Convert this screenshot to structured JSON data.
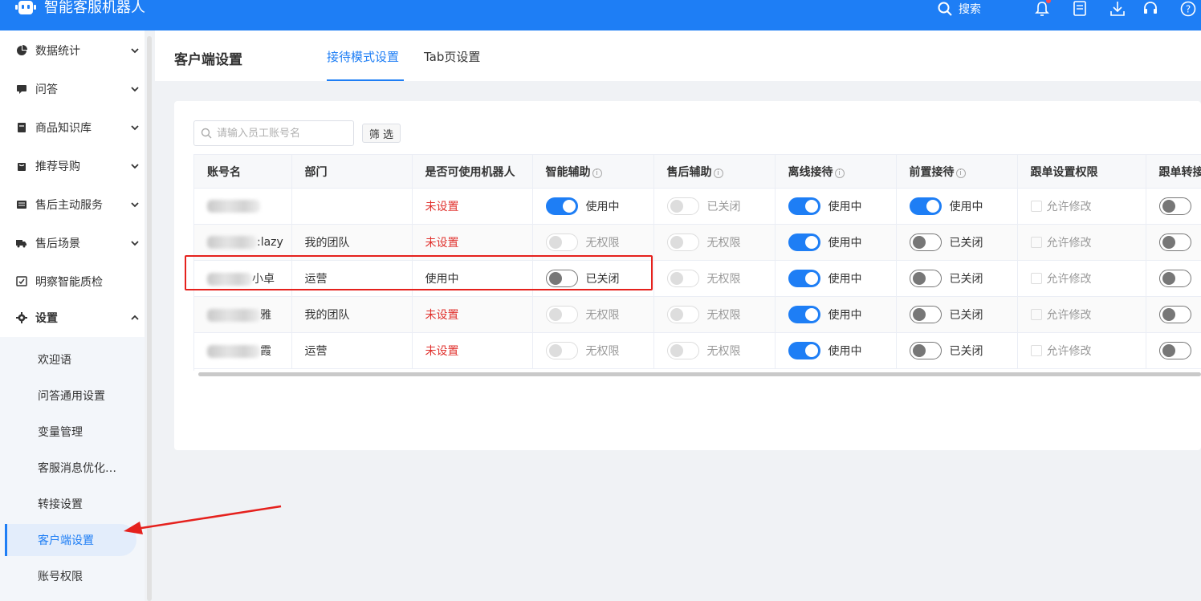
{
  "app": {
    "title": "智能客服机器人"
  },
  "topbar": {
    "search_label": "搜索"
  },
  "sidebar": {
    "items": [
      {
        "label": "数据统计"
      },
      {
        "label": "问答"
      },
      {
        "label": "商品知识库"
      },
      {
        "label": "推荐导购"
      },
      {
        "label": "售后主动服务"
      },
      {
        "label": "售后场景"
      },
      {
        "label": "明察智能质检"
      },
      {
        "label": "设置"
      }
    ],
    "submenu": [
      {
        "label": "欢迎语"
      },
      {
        "label": "问答通用设置"
      },
      {
        "label": "变量管理"
      },
      {
        "label": "客服消息优化…"
      },
      {
        "label": "转接设置"
      },
      {
        "label": "客户端设置"
      },
      {
        "label": "账号权限"
      }
    ]
  },
  "page": {
    "title": "客户端设置",
    "tabs": [
      {
        "label": "接待模式设置"
      },
      {
        "label": "Tab页设置"
      }
    ]
  },
  "filters": {
    "search_placeholder": "请输入员工账号名",
    "filter_button": "筛 选"
  },
  "table": {
    "headers": {
      "account": "账号名",
      "dept": "部门",
      "robot": "是否可使用机器人",
      "smart": "智能辅助",
      "aftersale": "售后辅助",
      "offline": "离线接待",
      "front": "前置接待",
      "follow_perm": "跟单设置权限",
      "follow_transfer": "跟单转接"
    },
    "info_glyph": "i",
    "rows": [
      {
        "account": "",
        "dept": "",
        "robot": "未设置",
        "smart": "使用中",
        "aftersale": "已关闭",
        "offline": "使用中",
        "front": "使用中",
        "follow_perm": "允许修改"
      },
      {
        "account": ":lazy",
        "dept": "我的团队",
        "robot": "未设置",
        "smart": "无权限",
        "aftersale": "无权限",
        "offline": "使用中",
        "front": "已关闭",
        "follow_perm": "允许修改"
      },
      {
        "account": "小卓",
        "dept": "运营",
        "robot": "使用中",
        "smart": "已关闭",
        "aftersale": "无权限",
        "offline": "使用中",
        "front": "已关闭",
        "follow_perm": "允许修改"
      },
      {
        "account": "雅",
        "dept": "我的团队",
        "robot": "未设置",
        "smart": "无权限",
        "aftersale": "无权限",
        "offline": "使用中",
        "front": "已关闭",
        "follow_perm": "允许修改"
      },
      {
        "account": "霞",
        "dept": "运营",
        "robot": "未设置",
        "smart": "无权限",
        "aftersale": "无权限",
        "offline": "使用中",
        "front": "已关闭",
        "follow_perm": "允许修改"
      }
    ]
  },
  "colors": {
    "accent": "#1e7ef5",
    "danger": "#e0312d",
    "annotation": "#e5211d"
  }
}
